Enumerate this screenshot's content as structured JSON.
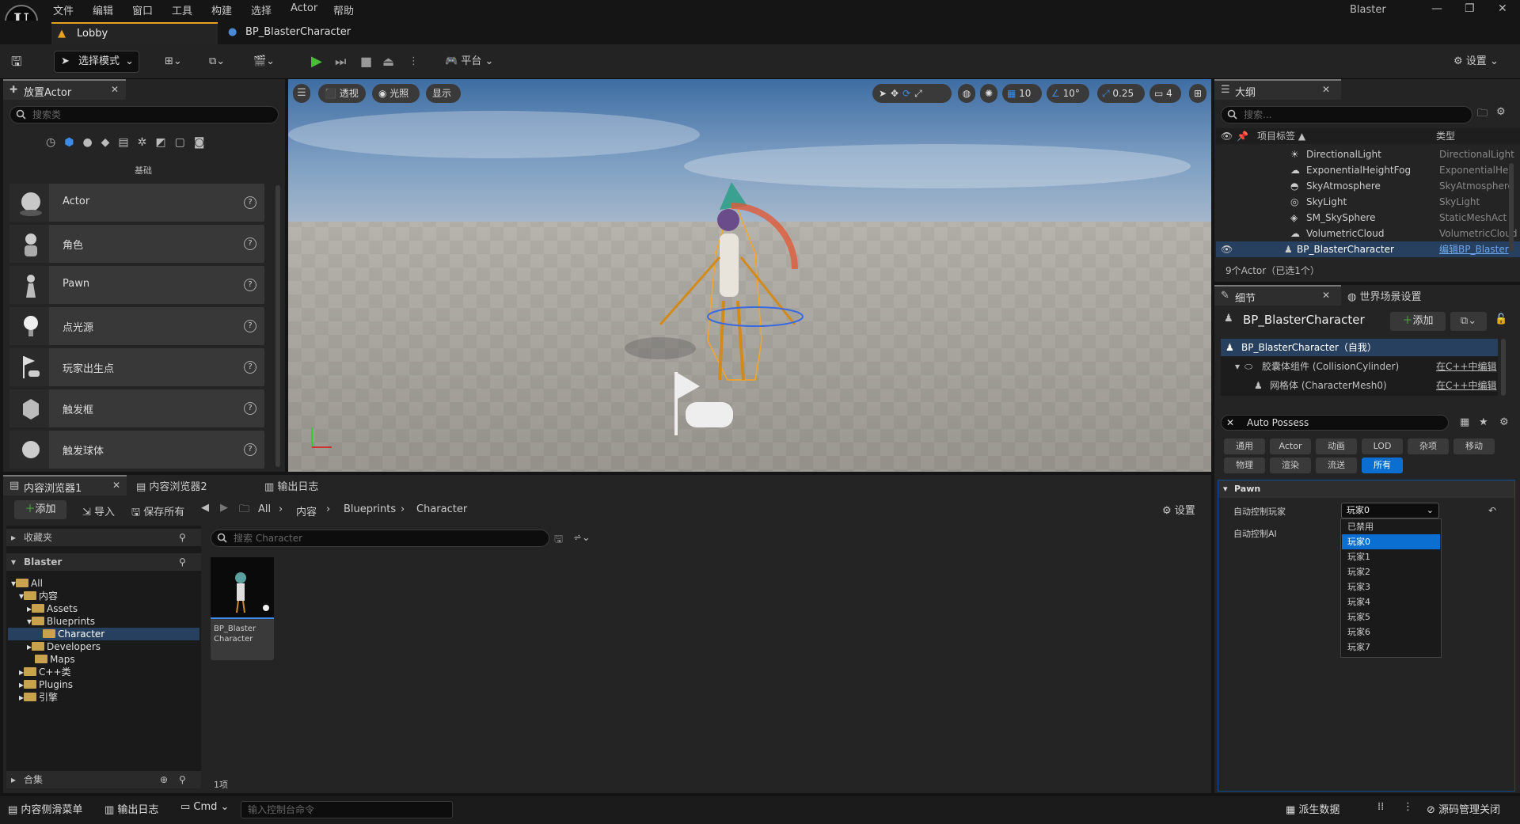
{
  "menu": [
    "文件",
    "编辑",
    "窗口",
    "工具",
    "构建",
    "选择",
    "Actor",
    "帮助"
  ],
  "window_title": "Blaster",
  "tabs": [
    {
      "label": "Lobby"
    },
    {
      "label": "BP_BlasterCharacter"
    }
  ],
  "toolbar": {
    "mode": "选择模式",
    "platform": "平台",
    "settings": "设置"
  },
  "place_actors": {
    "title": "放置Actor",
    "search_placeholder": "搜索类",
    "category": "基础",
    "items": [
      "Actor",
      "角色",
      "Pawn",
      "点光源",
      "玩家出生点",
      "触发框",
      "触发球体"
    ]
  },
  "viewport": {
    "perspective": "透视",
    "lit": "光照",
    "show": "显示",
    "grid": "10",
    "angle": "10°",
    "scale": "0.25",
    "camera": "4"
  },
  "outliner": {
    "title": "大纲",
    "search_placeholder": "搜索...",
    "col_label": "项目标签",
    "col_type": "类型",
    "rows": [
      {
        "name": "DirectionalLight",
        "type": "DirectionalLight"
      },
      {
        "name": "ExponentialHeightFog",
        "type": "ExponentialHe"
      },
      {
        "name": "SkyAtmosphere",
        "type": "SkyAtmosphere"
      },
      {
        "name": "SkyLight",
        "type": "SkyLight"
      },
      {
        "name": "SM_SkySphere",
        "type": "StaticMeshAct"
      },
      {
        "name": "VolumetricCloud",
        "type": "VolumetricCloud"
      },
      {
        "name": "BP_BlasterCharacter",
        "type": "编辑BP_Blaster"
      }
    ],
    "status": "9个Actor（已选1个）"
  },
  "details": {
    "tab": "细节",
    "tab2": "世界场景设置",
    "object": "BP_BlasterCharacter",
    "add": "添加",
    "components": [
      {
        "name": "BP_BlasterCharacter（自我）",
        "link": ""
      },
      {
        "name": "胶囊体组件 (CollisionCylinder)",
        "link": "在C++中编辑"
      },
      {
        "name": "网格体 (CharacterMesh0)",
        "link": "在C++中编辑"
      }
    ],
    "filter": "Auto Possess",
    "cats_row1": [
      "通用",
      "Actor",
      "动画",
      "LOD",
      "杂项",
      "移动"
    ],
    "cats_row2": [
      "物理",
      "渲染",
      "流送",
      "所有"
    ],
    "section": "Pawn",
    "prop1": "自动控制玩家",
    "prop1_value": "玩家0",
    "prop2": "自动控制AI",
    "options": [
      "已禁用",
      "玩家0",
      "玩家1",
      "玩家2",
      "玩家3",
      "玩家4",
      "玩家5",
      "玩家6",
      "玩家7"
    ]
  },
  "content": {
    "tab1": "内容浏览器1",
    "tab2": "内容浏览器2",
    "tab3": "输出日志",
    "add": "添加",
    "import": "导入",
    "save_all": "保存所有",
    "breadcrumb": [
      "All",
      "内容",
      "Blueprints",
      "Character"
    ],
    "settings": "设置",
    "favorites": "收藏夹",
    "project": "Blaster",
    "tree": [
      "All",
      "内容",
      "Assets",
      "Blueprints",
      "Character",
      "Developers",
      "Maps",
      "C++类",
      "Plugins",
      "引擎"
    ],
    "search_placeholder": "搜索 Character",
    "asset_name": "BP_Blaster Character",
    "count": "1项",
    "collections": "合集"
  },
  "statusbar": {
    "drawer": "内容侧滑菜单",
    "output": "输出日志",
    "cmd": "Cmd",
    "console_placeholder": "输入控制台命令",
    "source": "派生数据",
    "revision": "源码管理关闭"
  }
}
